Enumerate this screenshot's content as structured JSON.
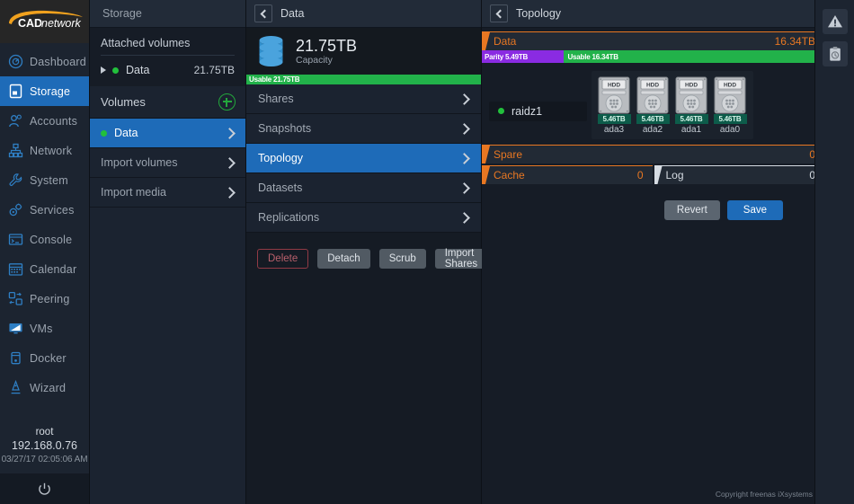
{
  "brand": {
    "logo_text_bold": "CAD",
    "logo_text_light": "network"
  },
  "sidebar": {
    "items": [
      {
        "label": "Dashboard",
        "icon": "dashboard-gauge-icon",
        "active": false
      },
      {
        "label": "Storage",
        "icon": "storage-icon",
        "active": true
      },
      {
        "label": "Accounts",
        "icon": "accounts-users-icon",
        "active": false
      },
      {
        "label": "Network",
        "icon": "network-tree-icon",
        "active": false
      },
      {
        "label": "System",
        "icon": "system-wrench-icon",
        "active": false
      },
      {
        "label": "Services",
        "icon": "services-gear-icon",
        "active": false
      },
      {
        "label": "Console",
        "icon": "console-terminal-icon",
        "active": false
      },
      {
        "label": "Calendar",
        "icon": "calendar-icon",
        "active": false
      },
      {
        "label": "Peering",
        "icon": "peering-icon",
        "active": false
      },
      {
        "label": "VMs",
        "icon": "vms-monitor-icon",
        "active": false
      },
      {
        "label": "Docker",
        "icon": "docker-container-icon",
        "active": false
      },
      {
        "label": "Wizard",
        "icon": "wizard-hat-icon",
        "active": false
      }
    ],
    "user": "root",
    "ip": "192.168.0.76",
    "datetime": "03/27/17  02:05:06 AM",
    "power_icon": "power-icon"
  },
  "storage_panel": {
    "header": "Storage",
    "attached_title": "Attached volumes",
    "attached": {
      "name": "Data",
      "size": "21.75TB",
      "status_color": "#22c03c"
    },
    "volumes_label": "Volumes",
    "add_icon": "plus-circle-icon",
    "rows": [
      {
        "label": "Data",
        "selected": true,
        "has_dot": true
      },
      {
        "label": "Import volumes",
        "selected": false,
        "has_dot": false
      },
      {
        "label": "Import media",
        "selected": false,
        "has_dot": false
      }
    ]
  },
  "volume_panel": {
    "back_icon": "chevron-left-icon",
    "title": "Data",
    "capacity_icon": "database-cylinder-icon",
    "capacity_value": "21.75TB",
    "capacity_label": "Capacity",
    "usable_bar_label": "Usable 21.75TB",
    "menu": [
      {
        "label": "Shares",
        "selected": false
      },
      {
        "label": "Snapshots",
        "selected": false
      },
      {
        "label": "Topology",
        "selected": true
      },
      {
        "label": "Datasets",
        "selected": false
      },
      {
        "label": "Replications",
        "selected": false
      }
    ],
    "buttons": [
      {
        "label": "Delete",
        "style": "danger"
      },
      {
        "label": "Detach",
        "style": "grey"
      },
      {
        "label": "Scrub",
        "style": "grey"
      },
      {
        "label": "Import Shares",
        "style": "grey"
      }
    ]
  },
  "topology_panel": {
    "back_icon": "chevron-left-icon",
    "title": "Topology",
    "data_vdev": {
      "name": "Data",
      "value": "16.34TB",
      "parity_label": "Parity 5.49TB",
      "parity_pct": 24,
      "usable_label": "Usable 16.34TB",
      "raid_label": "raidz1",
      "raid_status_color": "#22c03c",
      "disks": [
        {
          "size": "5.46TB",
          "name": "ada3",
          "icon": "hdd-icon"
        },
        {
          "size": "5.46TB",
          "name": "ada2",
          "icon": "hdd-icon"
        },
        {
          "size": "5.46TB",
          "name": "ada1",
          "icon": "hdd-icon"
        },
        {
          "size": "5.46TB",
          "name": "ada0",
          "icon": "hdd-icon"
        }
      ]
    },
    "spare": {
      "name": "Spare",
      "value": "0"
    },
    "cache": {
      "name": "Cache",
      "value": "0"
    },
    "log": {
      "name": "Log",
      "value": "0"
    },
    "revert_label": "Revert",
    "save_label": "Save",
    "copyright": "Copyright freenas iXsystems"
  },
  "rail": {
    "buttons": [
      {
        "icon": "alert-warning-icon"
      },
      {
        "icon": "tasks-clipboard-icon"
      }
    ]
  },
  "colors": {
    "accent_blue": "#1e6bb8",
    "accent_orange": "#e87722",
    "green": "#22b24a",
    "purple": "#8a2be2",
    "danger": "#b9606c"
  }
}
